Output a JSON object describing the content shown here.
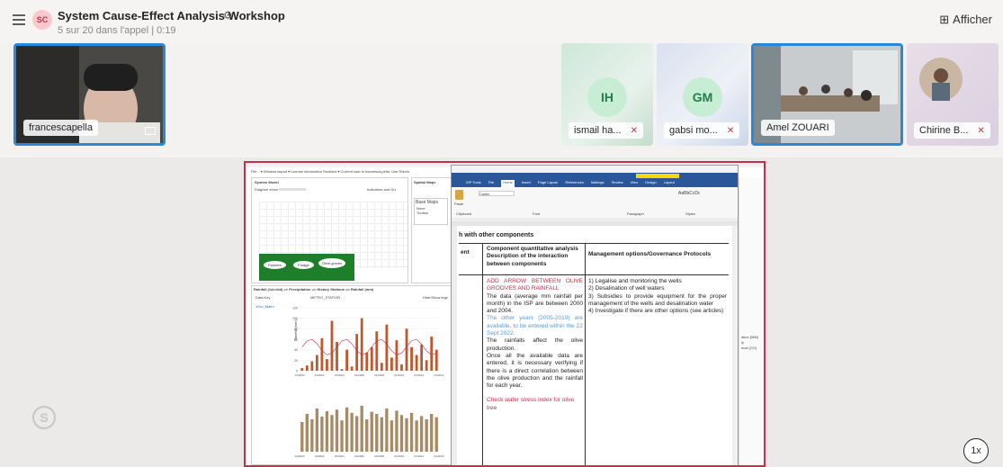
{
  "header": {
    "avatar_initials": "SC",
    "title": "System Cause-Effect Analysis Workshop",
    "subtitle": "5 sur 20 dans l'appel | 0:19",
    "view_button": "Afficher"
  },
  "participants": [
    {
      "name": "francescapella"
    },
    {
      "initials": "IH",
      "name": "ismail ha..."
    },
    {
      "initials": "GM",
      "name": "gabsi mo..."
    },
    {
      "name": "Amel ZOUARI"
    },
    {
      "name": "Chirine B..."
    }
  ],
  "share": {
    "menu_bar": "File... ▾  Window layout ▾  License information  Sections ▾  Current user is francesca.pella. Use Robrio",
    "system_model_title": "System Model",
    "diagram_zoom_label": "Diagram zoom",
    "indicators_label": "Indicators and Gui",
    "spatial_maps_title": "Spatial Maps",
    "base_maps_label": "Base Maps",
    "base_maps_items": [
      "None",
      "Tunisia"
    ],
    "nodes": [
      "Farmers",
      "Forage",
      "Olive groves"
    ],
    "rainfall_title": "Rainfall (1d=1dd) => Precipitation => History Stations => Rainfall (mm)",
    "data_key_label": "Data Key",
    "meteo_station": "METEO_STATION",
    "hide_show": "Hide/Show legs",
    "series_label": "10cc_Matm",
    "chart_ylabel": "Rainfall (mm)",
    "chart_yticks": [
      "120",
      "100",
      "80",
      "60",
      "40",
      "20",
      "0"
    ],
    "chart_xticks": [
      "01/2000",
      "01/2002",
      "01/2004",
      "01/2006",
      "01/2008",
      "01/2010",
      "01/2012",
      "01/2014"
    ],
    "reporting_tool_title": "Reporting tool",
    "ribbon_tabs": [
      "ISP Tools",
      "File",
      "Home",
      "Insert",
      "Page Layout",
      "References",
      "Mailings",
      "Review",
      "View",
      "Design",
      "Layout"
    ],
    "ribbon_groups": [
      "Clipboard",
      "Font",
      "Paragraph",
      "Styles"
    ],
    "font_name": "Calibri",
    "styles_preview": "AaBbCcDc",
    "paste_label": "Paste",
    "doc_heading": "h with other components",
    "col_ent": "ent",
    "col_analysis": "Component quantitative analysis Description of the interaction between components",
    "col_management": "Management options/Governance Protocols",
    "cell_red_1": "ADD ARROW BETWEEN OLIVE GROOVES AND RAINFALL",
    "cell_text_1": "The data (average mm rainfall per month) in the ISP are between 2000 and 2004.",
    "cell_blue": "The other years (2005-2019) are available, to be entered within the 22 Sept 2022.",
    "cell_text_2": "The rainfalls affect the olive production.",
    "cell_text_3": "Once all the available data are entered, it is necessary verifying if there is a direct correlation between the olive production and the rainfall for each year.",
    "cell_red_2": "Check water stress index for olive tree",
    "management_items": [
      "1) Legalise and monitoring the wells",
      "2) Desalination of well waters",
      "3) Subsidies to provide equipment for the proper management of the wells and desalination water",
      "4) Investigate if there are other options (see articles)"
    ],
    "right_panel_text": "ation (MM)\nly\nrical (CO)"
  },
  "playback_speed": "1x",
  "chart_data": {
    "type": "bar",
    "ylabel": "Rainfall (mm)",
    "ylim": [
      0,
      120
    ],
    "values": [
      5,
      10,
      18,
      30,
      62,
      22,
      95,
      55,
      3,
      40,
      8,
      70,
      100,
      35,
      45,
      75,
      15,
      88,
      25,
      58,
      12,
      80,
      45,
      30,
      50,
      20,
      65,
      40
    ],
    "lower_values": [
      55,
      70,
      60,
      80,
      65,
      75,
      68,
      78,
      58,
      82,
      72,
      66,
      85,
      60,
      74,
      70,
      64,
      80,
      58,
      76,
      68,
      62,
      72,
      58,
      66,
      60,
      70,
      64
    ]
  }
}
